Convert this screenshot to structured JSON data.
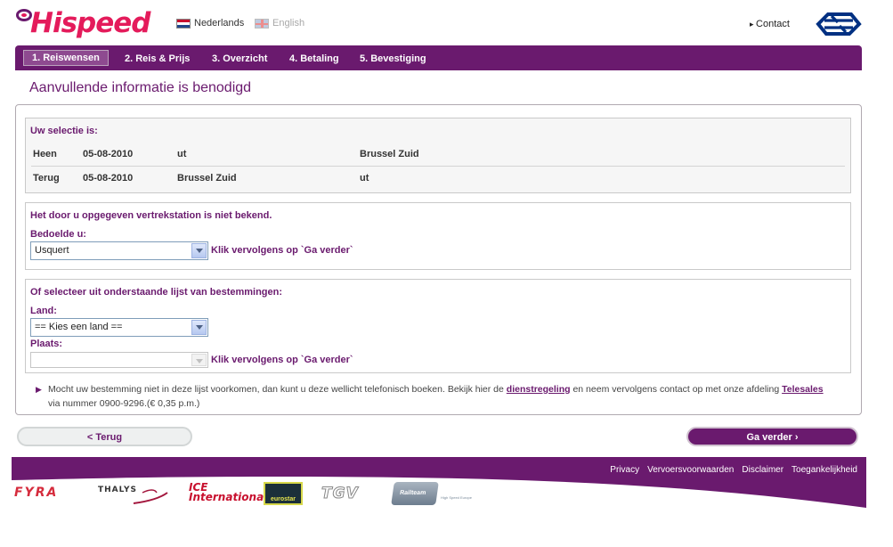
{
  "brand": {
    "logo_text": "Hispeed",
    "accent": "#6a1a6e",
    "pink": "#e41b5b"
  },
  "header": {
    "languages": [
      {
        "label": "Nederlands",
        "icon": "flag-nl-icon",
        "active": true
      },
      {
        "label": "English",
        "icon": "flag-uk-icon",
        "active": false
      }
    ],
    "contact_label": "Contact",
    "ns_logo": "ns-logo"
  },
  "steps": [
    {
      "label": "1. Reiswensen",
      "active": true
    },
    {
      "label": "2. Reis & Prijs",
      "active": false
    },
    {
      "label": "3. Overzicht",
      "active": false
    },
    {
      "label": "4. Betaling",
      "active": false
    },
    {
      "label": "5. Bevestiging",
      "active": false
    }
  ],
  "page_title": "Aanvullende informatie is benodigd",
  "selection": {
    "title": "Uw selectie is:",
    "rows": [
      {
        "direction": "Heen",
        "date": "05-08-2010",
        "from": "ut",
        "to": "Brussel Zuid"
      },
      {
        "direction": "Terug",
        "date": "05-08-2010",
        "from": "Brussel Zuid",
        "to": "ut"
      }
    ]
  },
  "unknown_station": {
    "title": "Het door u opgegeven vertrekstation is niet bekend.",
    "label": "Bedoelde u:",
    "selected": "Usquert",
    "hint": "Klik vervolgens op `Ga verder`"
  },
  "destination_list": {
    "title": "Of selecteer uit onderstaande lijst van bestemmingen:",
    "country_label": "Land:",
    "country_selected": "== Kies een land ==",
    "place_label": "Plaats:",
    "place_selected": "",
    "hint": "Klik vervolgens op `Ga verder`"
  },
  "note": {
    "text_1": "Mocht uw bestemming niet in deze lijst voorkomen, dan kunt u deze wellicht telefonisch boeken. Bekijk hier de ",
    "link_1": "dienstregeling",
    "text_2": " en neem vervolgens contact op met onze afdeling ",
    "link_2": "Telesales",
    "text_3": "via nummer 0900-9296.(€ 0,35 p.m.)"
  },
  "buttons": {
    "back": "< Terug",
    "next": "Ga verder ›"
  },
  "footer": {
    "links": [
      "Privacy",
      "Vervoersvoorwaarden",
      "Disclaimer",
      "Toegankelijkheid"
    ],
    "partners": [
      "FYRA",
      "THALYS",
      "ICE International",
      "eurostar",
      "TGV",
      "Railteam"
    ],
    "railteam_tagline": "High Speed Europe"
  }
}
